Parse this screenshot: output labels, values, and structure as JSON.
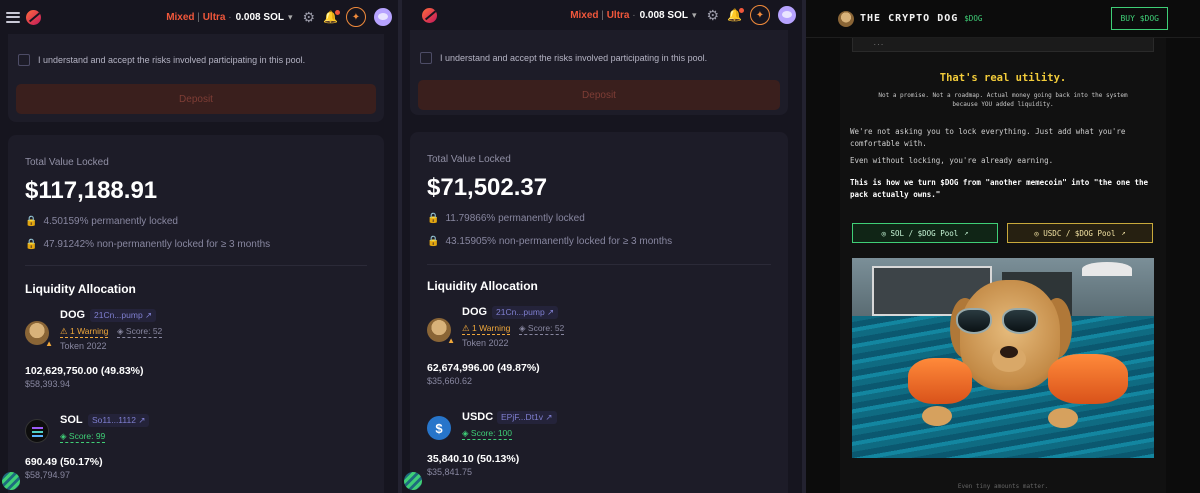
{
  "panels": [
    {
      "topbar": {
        "net_label": "Mixed",
        "ultra_label": "Ultra",
        "sep": " | ",
        "dot": " · ",
        "sol_balance": "0.008 SOL"
      },
      "checkbox_label": "I understand and accept the risks involved participating in this pool.",
      "deposit_label": "Deposit",
      "tvl_label": "Total Value Locked",
      "tvl_value": "$117,188.91",
      "perm_locked": "4.50159% permanently locked",
      "nonperm_locked": "47.91242% non-permanently locked for ≥ 3 months",
      "alloc_title": "Liquidity Allocation",
      "tokens": [
        {
          "name": "DOG",
          "addr": "21Cn...pump",
          "warning": "1 Warning",
          "score": "Score: 52",
          "sub": "Token 2022",
          "amount": "102,629,750.00 (49.83%)",
          "usd": "$58,393.94"
        },
        {
          "name": "SOL",
          "addr": "So11...1112",
          "score": "Score: 99",
          "amount": "690.49 (50.17%)",
          "usd": "$58,794.97"
        }
      ]
    },
    {
      "topbar": {
        "net_label": "Mixed",
        "ultra_label": "Ultra",
        "sep": " | ",
        "dot": " · ",
        "sol_balance": "0.008 SOL"
      },
      "checkbox_label": "I understand and accept the risks involved participating in this pool.",
      "deposit_label": "Deposit",
      "tvl_label": "Total Value Locked",
      "tvl_value": "$71,502.37",
      "perm_locked": "11.79866% permanently locked",
      "nonperm_locked": "43.15905% non-permanently locked for ≥ 3 months",
      "alloc_title": "Liquidity Allocation",
      "tokens": [
        {
          "name": "DOG",
          "addr": "21Cn...pump",
          "warning": "1 Warning",
          "score": "Score: 52",
          "sub": "Token 2022",
          "amount": "62,674,996.00 (49.87%)",
          "usd": "$35,660.62"
        },
        {
          "name": "USDC",
          "addr": "EPjF...Dt1v",
          "score": "Score: 100",
          "amount": "35,840.10 (50.13%)",
          "usd": "$35,841.75"
        }
      ]
    }
  ],
  "crypto_dog": {
    "brand": "THE CRYPTO DOG",
    "ticker": "$DOG",
    "buy_label": "BUY $DOG",
    "quote_tail": "...",
    "heading": "That's real utility.",
    "subline": "Not a promise. Not a roadmap. Actual money going back into the system because YOU added liquidity.",
    "para1": "We're not asking you to lock everything. Just add what you're comfortable with.",
    "para2": "Even without locking, you're already earning.",
    "para3": "This is how we turn $DOG from \"another memecoin\" into \"the one the pack actually owns.\"",
    "pool_sol": "SOL / $DOG Pool",
    "pool_usdc": "USDC / $DOG Pool",
    "footer": "Even tiny amounts matter."
  },
  "colors": {
    "accent_orange": "#f0573b",
    "score_green": "#3fcf77",
    "warning": "#f0a83b",
    "gold": "#f2cc3a"
  },
  "icons": [
    "menu-icon",
    "logo-icon",
    "gear-icon",
    "bell-icon",
    "sparkle-icon",
    "avatar-icon",
    "lock-icon",
    "external-link-icon",
    "shield-warning-icon",
    "score-icon"
  ]
}
